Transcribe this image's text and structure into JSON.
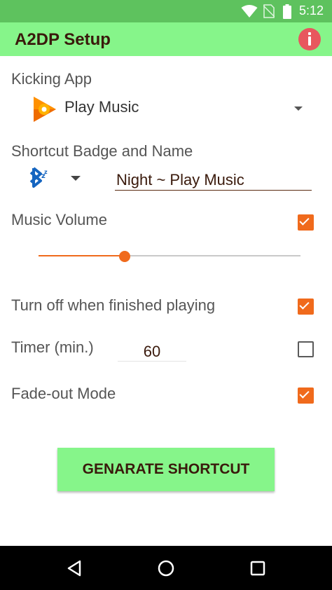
{
  "status_bar": {
    "time": "5:12",
    "icons": [
      "wifi-icon",
      "no-sim-icon",
      "battery-icon"
    ]
  },
  "app_bar": {
    "title": "A2DP Setup",
    "action_icon": "info-icon"
  },
  "kicking_app": {
    "label": "Kicking App",
    "selected_app": "Play Music",
    "app_icon": "play-music-icon"
  },
  "shortcut": {
    "label": "Shortcut Badge and Name",
    "badge_icon": "bluetooth-badge-icon",
    "name_value": "Night ~ Play Music"
  },
  "music_volume": {
    "label": "Music Volume",
    "checked": true,
    "slider_value": 0.33
  },
  "turn_off": {
    "label": "Turn off when finished playing",
    "checked": true
  },
  "timer": {
    "label": "Timer (min.)",
    "value": "60",
    "checked": false
  },
  "fade_out": {
    "label": "Fade-out Mode",
    "checked": true
  },
  "generate_button": {
    "label": "GENARATE SHORTCUT"
  },
  "nav_bar": {
    "buttons": [
      "back-icon",
      "home-icon",
      "recents-icon"
    ]
  },
  "colors": {
    "status_bar": "#5ec25e",
    "app_bar": "#86f58a",
    "accent": "#f06a1c",
    "info": "#e8575e",
    "title_text": "#3a1a0c"
  }
}
